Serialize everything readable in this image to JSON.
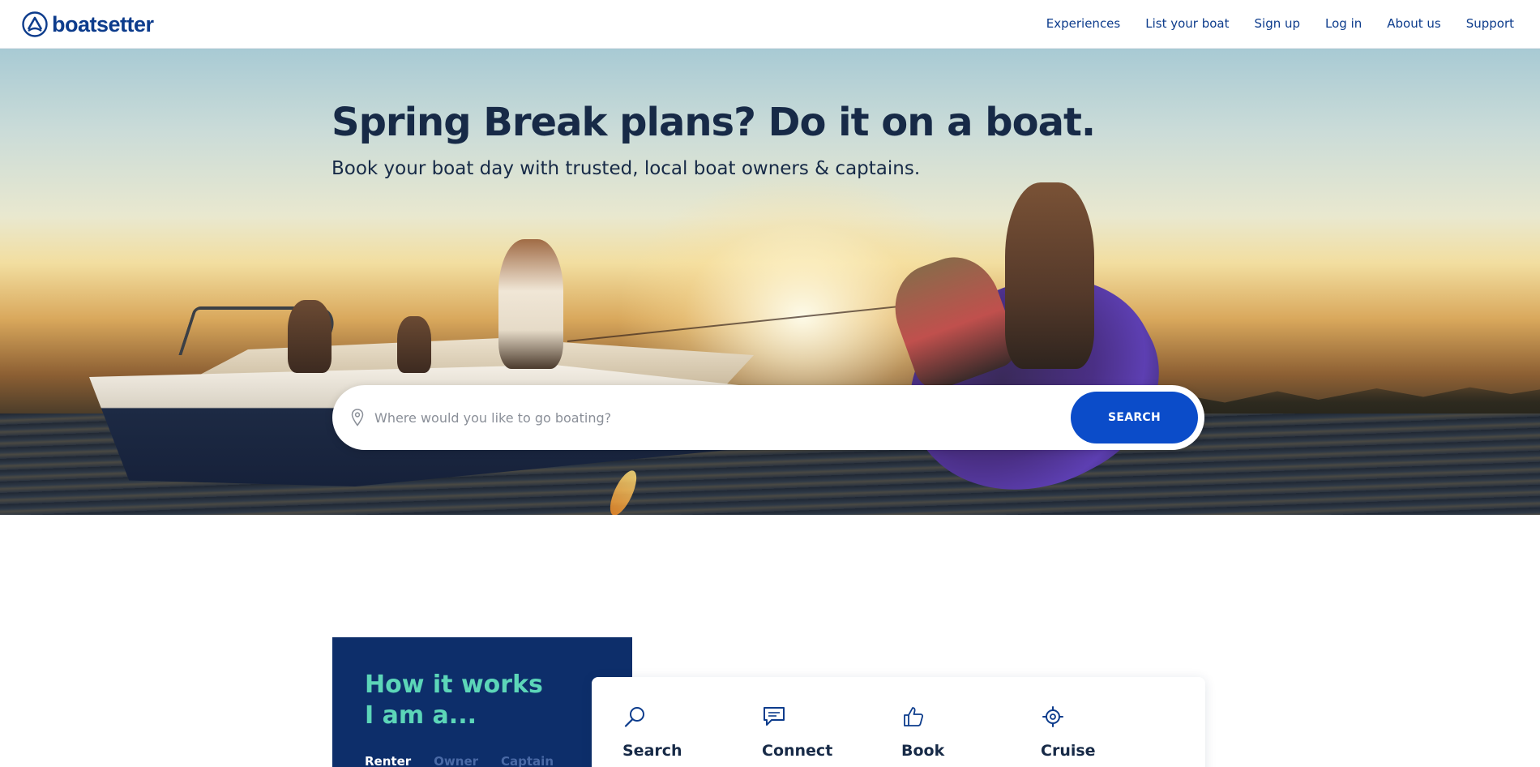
{
  "brand": {
    "name": "boatsetter",
    "color": "#0d3c8c"
  },
  "nav": {
    "links": [
      "Experiences",
      "List your boat",
      "Sign up",
      "Log in",
      "About us",
      "Support"
    ]
  },
  "hero": {
    "title": "Spring Break plans? Do it on a boat.",
    "subtitle": "Book your boat day with trusted, local boat owners & captains.",
    "search": {
      "placeholder": "Where would you like to go boating?",
      "value": "",
      "icon": "location-pin-icon",
      "button_label": "SEARCH",
      "button_color": "#0b4cc9"
    }
  },
  "how_it_works": {
    "title_line1": "How it works",
    "title_line2": "I am a...",
    "accent_color": "#5cd6b8",
    "tabs": [
      {
        "label": "Renter",
        "active": true
      },
      {
        "label": "Owner",
        "active": false
      },
      {
        "label": "Captain",
        "active": false
      }
    ],
    "steps": [
      {
        "label": "Search",
        "icon": "magnifier-icon"
      },
      {
        "label": "Connect",
        "icon": "chat-bubble-icon"
      },
      {
        "label": "Book",
        "icon": "thumbs-up-icon"
      },
      {
        "label": "Cruise",
        "icon": "ship-wheel-icon"
      }
    ]
  }
}
